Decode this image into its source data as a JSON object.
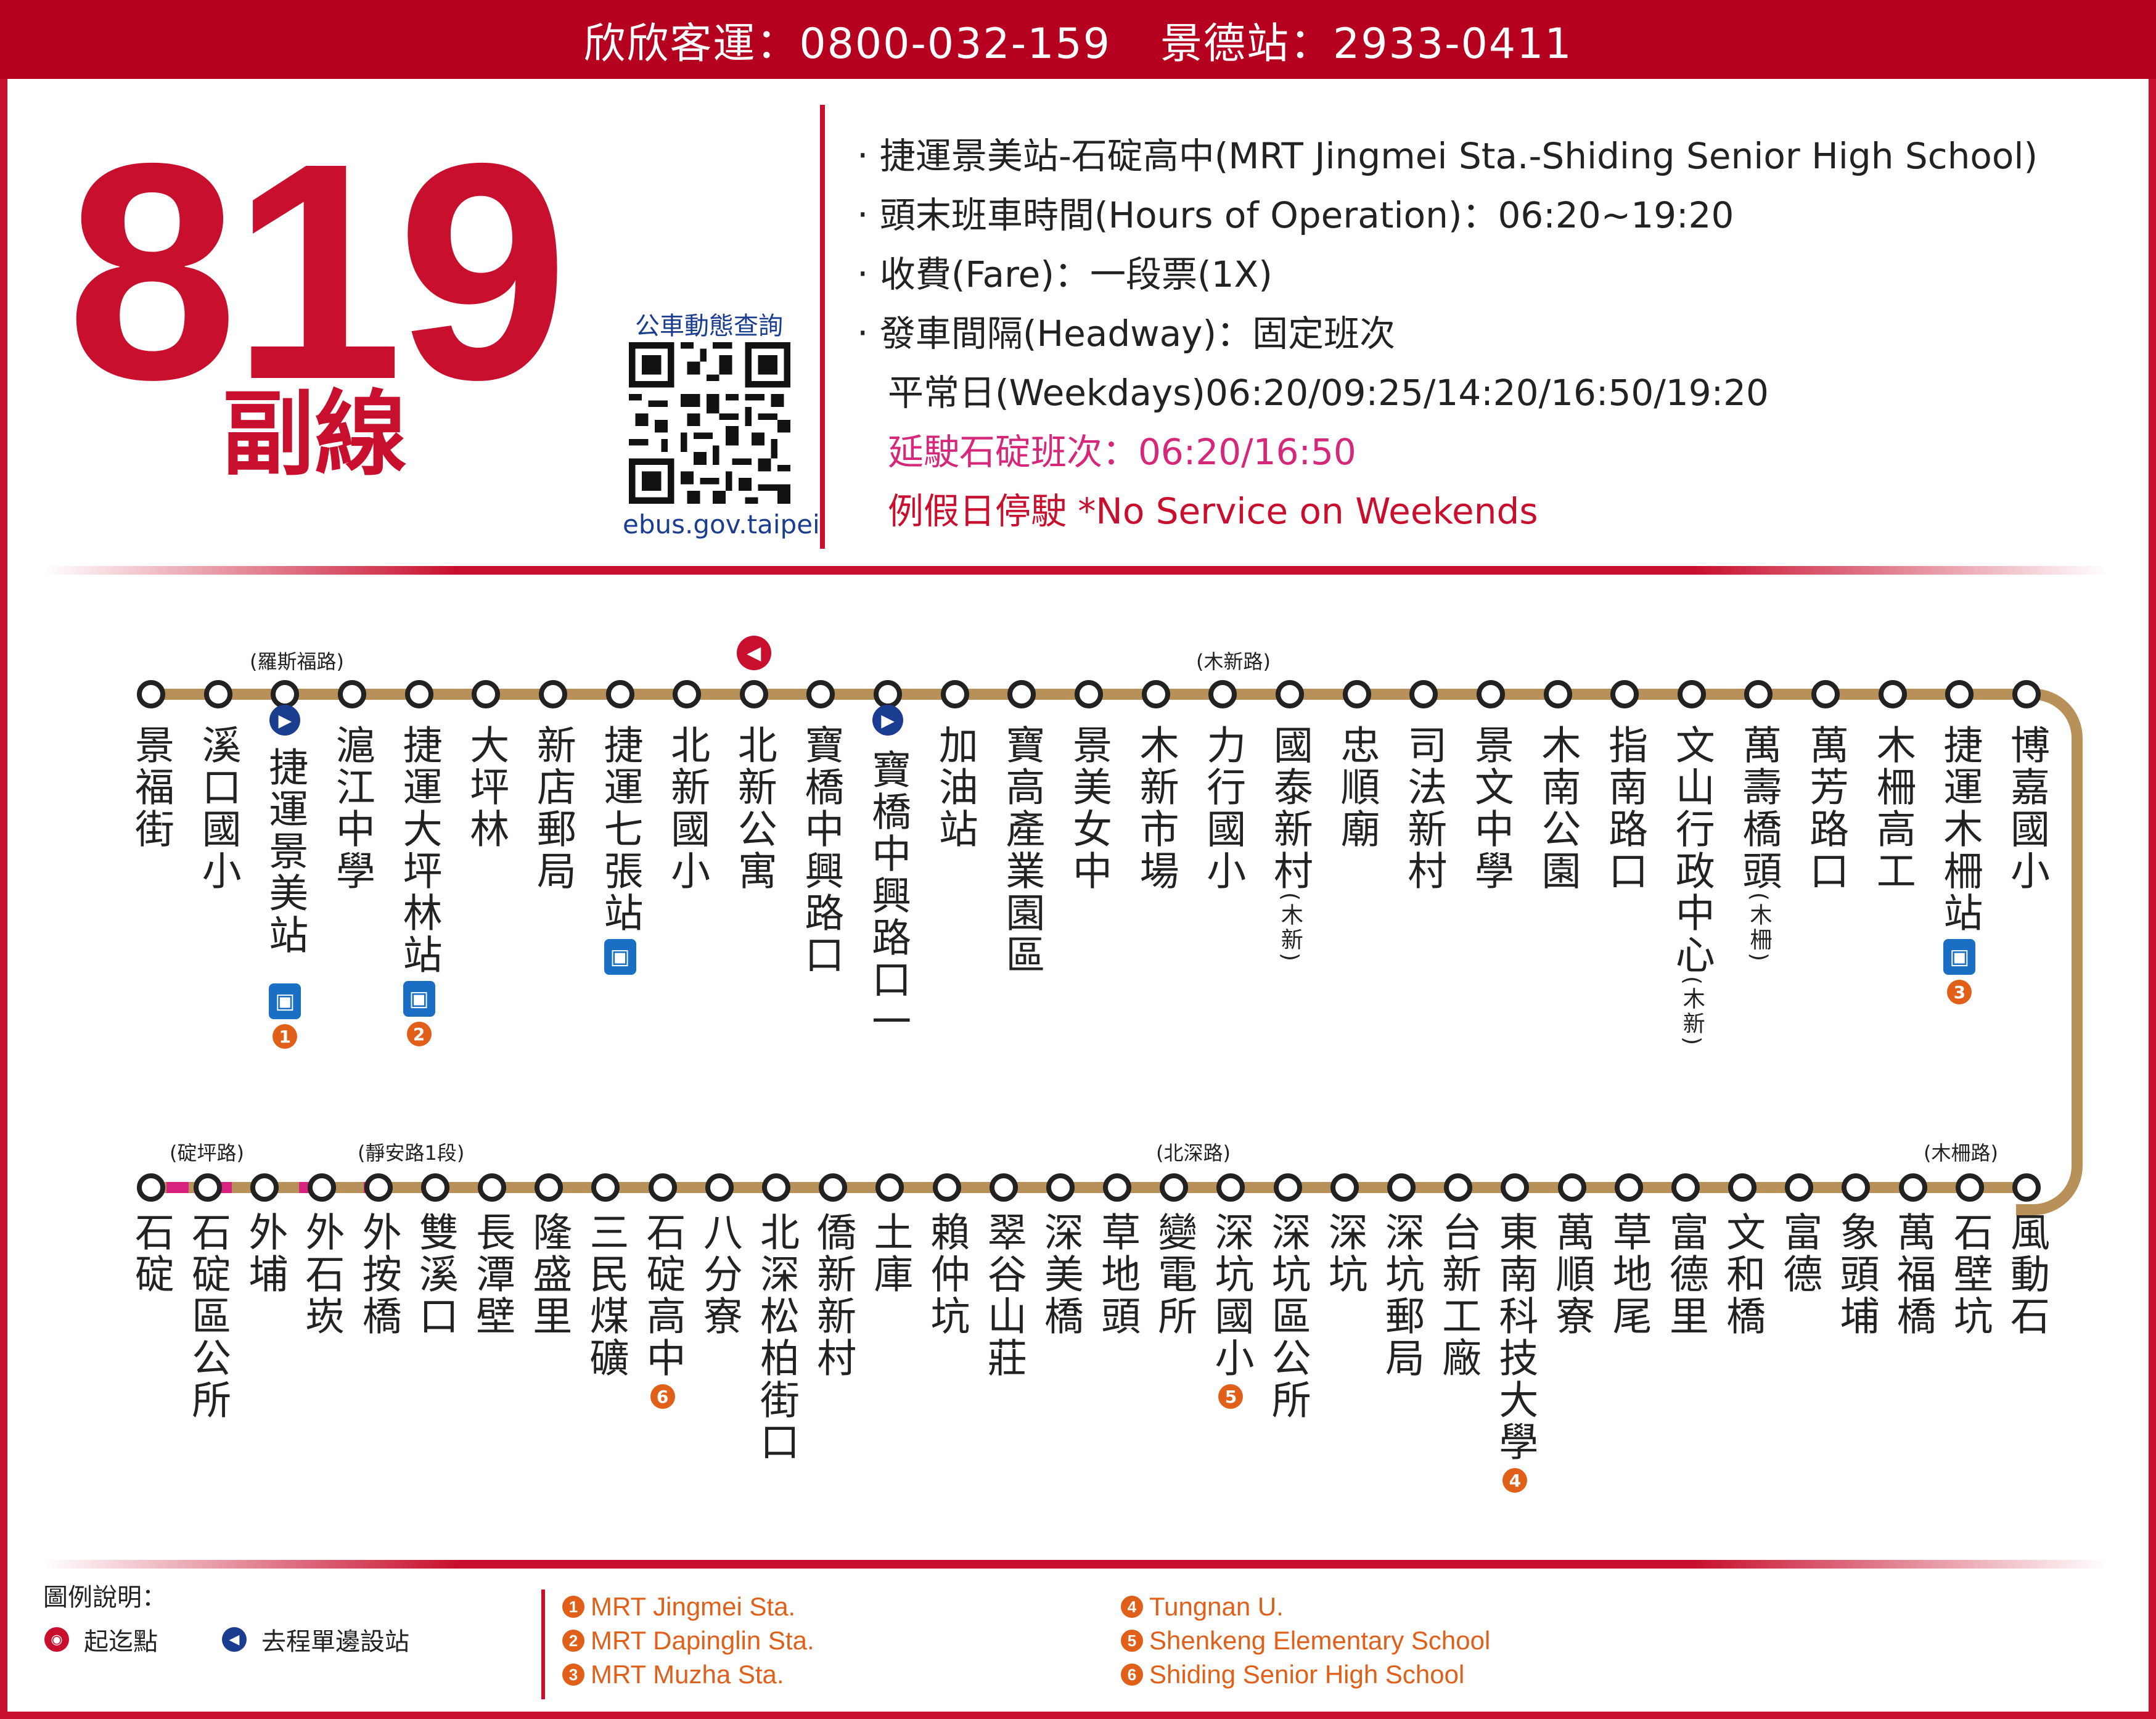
{
  "header": {
    "operator": "欣欣客運：0800-032-159",
    "station": "景德站：2933-0411"
  },
  "route": {
    "number": "819",
    "subline": "副線"
  },
  "qr": {
    "title": "公車動態查詢",
    "url": "ebus.gov.taipei"
  },
  "info": {
    "line1": "‧ 捷運景美站-石碇高中(MRT Jingmei Sta.-Shiding Senior High School)",
    "line2": "‧ 頭末班車時間(Hours of Operation)：06:20~19:20",
    "line3": "‧ 收費(Fare)：一段票(1X)",
    "line4": "‧ 發車間隔(Headway)：固定班次",
    "line5": "平常日(Weekdays)06:20/09:25/14:20/16:50/19:20",
    "line6": "延駛石碇班次：06:20/16:50",
    "line7": "例假日停駛 *No Service on Weekends"
  },
  "road_labels": {
    "roosevelt": "(羅斯福路)",
    "muxin": "(木新路)",
    "dingping": "(碇坪路)",
    "jingan": "(靜安路1段)",
    "beishen": "(北深路)",
    "muzha": "(木柵路)"
  },
  "top_row": [
    {
      "name": "景福街"
    },
    {
      "name": "溪口國小"
    },
    {
      "name": "捷運景美站",
      "badge": "1",
      "mrt": true,
      "oneway": true
    },
    {
      "name": "滬江中學"
    },
    {
      "name": "捷運大坪林站",
      "badge": "2",
      "mrt": true
    },
    {
      "name": "大坪林"
    },
    {
      "name": "新店郵局"
    },
    {
      "name": "捷運七張站",
      "mrt": true
    },
    {
      "name": "北新國小"
    },
    {
      "name": "北新公寓",
      "start": true
    },
    {
      "name": "寶橋中興路口"
    },
    {
      "name": "寶橋中興路口一",
      "oneway": true
    },
    {
      "name": "加油站"
    },
    {
      "name": "寶高產業園區"
    },
    {
      "name": "景美女中"
    },
    {
      "name": "木新市場"
    },
    {
      "name": "力行國小"
    },
    {
      "name": "國泰新村",
      "note": "(木新)"
    },
    {
      "name": "忠順廟"
    },
    {
      "name": "司法新村"
    },
    {
      "name": "景文中學"
    },
    {
      "name": "木南公園"
    },
    {
      "name": "指南路口"
    },
    {
      "name": "文山行政中心",
      "note": "(木新)"
    },
    {
      "name": "萬壽橋頭",
      "note": "(木柵)"
    },
    {
      "name": "萬芳路口"
    },
    {
      "name": "木柵高工"
    },
    {
      "name": "捷運木柵站",
      "badge": "3",
      "mrt": true
    },
    {
      "name": "博嘉國小"
    }
  ],
  "bottom_row": [
    {
      "name": "石碇"
    },
    {
      "name": "石碇區公所"
    },
    {
      "name": "外埔"
    },
    {
      "name": "外石崁"
    },
    {
      "name": "外按橋"
    },
    {
      "name": "雙溪口"
    },
    {
      "name": "長潭壁"
    },
    {
      "name": "隆盛里"
    },
    {
      "name": "三民煤礦"
    },
    {
      "name": "石碇高中",
      "badge": "6"
    },
    {
      "name": "八分寮"
    },
    {
      "name": "北深松柏街口"
    },
    {
      "name": "僑新新村"
    },
    {
      "name": "土庫"
    },
    {
      "name": "賴仲坑"
    },
    {
      "name": "翠谷山莊"
    },
    {
      "name": "深美橋"
    },
    {
      "name": "草地頭"
    },
    {
      "name": "變電所"
    },
    {
      "name": "深坑國小",
      "badge": "5"
    },
    {
      "name": "深坑區公所"
    },
    {
      "name": "深坑"
    },
    {
      "name": "深坑郵局"
    },
    {
      "name": "台新工廠"
    },
    {
      "name": "東南科技大學",
      "badge": "4"
    },
    {
      "name": "萬順寮"
    },
    {
      "name": "草地尾"
    },
    {
      "name": "富德里"
    },
    {
      "name": "文和橋"
    },
    {
      "name": "富德"
    },
    {
      "name": "象頭埔"
    },
    {
      "name": "萬福橋"
    },
    {
      "name": "石壁坑"
    },
    {
      "name": "風動石"
    }
  ],
  "legend": {
    "title": "圖例說明：",
    "start_label": "起迄點",
    "oneway_label": "去程單邊設站",
    "stations": [
      {
        "num": "1",
        "name": "MRT Jingmei Sta."
      },
      {
        "num": "2",
        "name": "MRT Dapinglin Sta."
      },
      {
        "num": "3",
        "name": "MRT Muzha Sta."
      },
      {
        "num": "4",
        "name": "Tungnan U."
      },
      {
        "num": "5",
        "name": "Shenkeng Elementary School"
      },
      {
        "num": "6",
        "name": "Shiding Senior High School"
      }
    ]
  },
  "colors": {
    "brand_red": "#c8102e",
    "route_line": "#b8905a",
    "pink_segment": "#d9237f",
    "badge_orange": "#e0601a",
    "mrt_blue": "#1a6fc4"
  }
}
